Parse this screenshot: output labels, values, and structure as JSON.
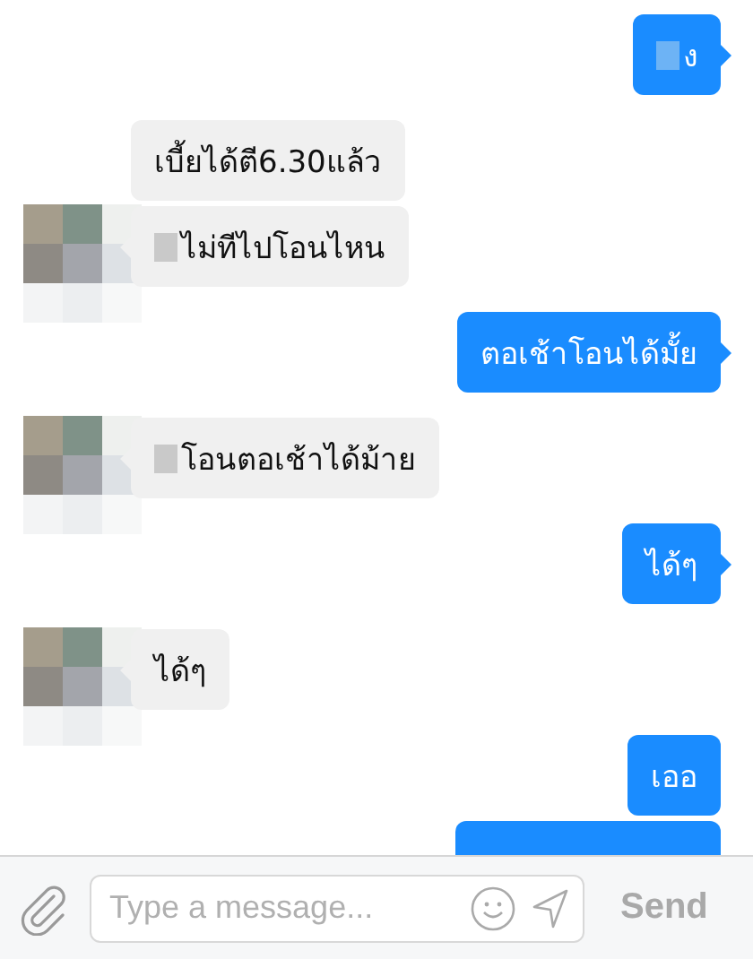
{
  "messages": [
    {
      "kind": "text",
      "outgoing": true,
      "redacted": true,
      "text": "ง"
    },
    {
      "kind": "text",
      "outgoing": false,
      "redacted": false,
      "text": "เบี้ยได้ตี6.30แล้ว"
    },
    {
      "kind": "text",
      "outgoing": false,
      "redacted": true,
      "text": "ไม่ทีไปโอนไหน"
    },
    {
      "kind": "text",
      "outgoing": true,
      "redacted": false,
      "text": "ตอเช้าโอนได้มั้ย"
    },
    {
      "kind": "text",
      "outgoing": false,
      "redacted": true,
      "text": "โอนตอเช้าได้ม้าย"
    },
    {
      "kind": "text",
      "outgoing": true,
      "redacted": false,
      "text": "ได้ๆ"
    },
    {
      "kind": "text",
      "outgoing": false,
      "redacted": false,
      "text": "ได้ๆ"
    },
    {
      "kind": "text",
      "outgoing": true,
      "redacted": false,
      "text": "เออ"
    },
    {
      "kind": "cut-off",
      "outgoing": true
    }
  ],
  "composer": {
    "placeholder": "Type a message...",
    "send_label": "Send"
  }
}
